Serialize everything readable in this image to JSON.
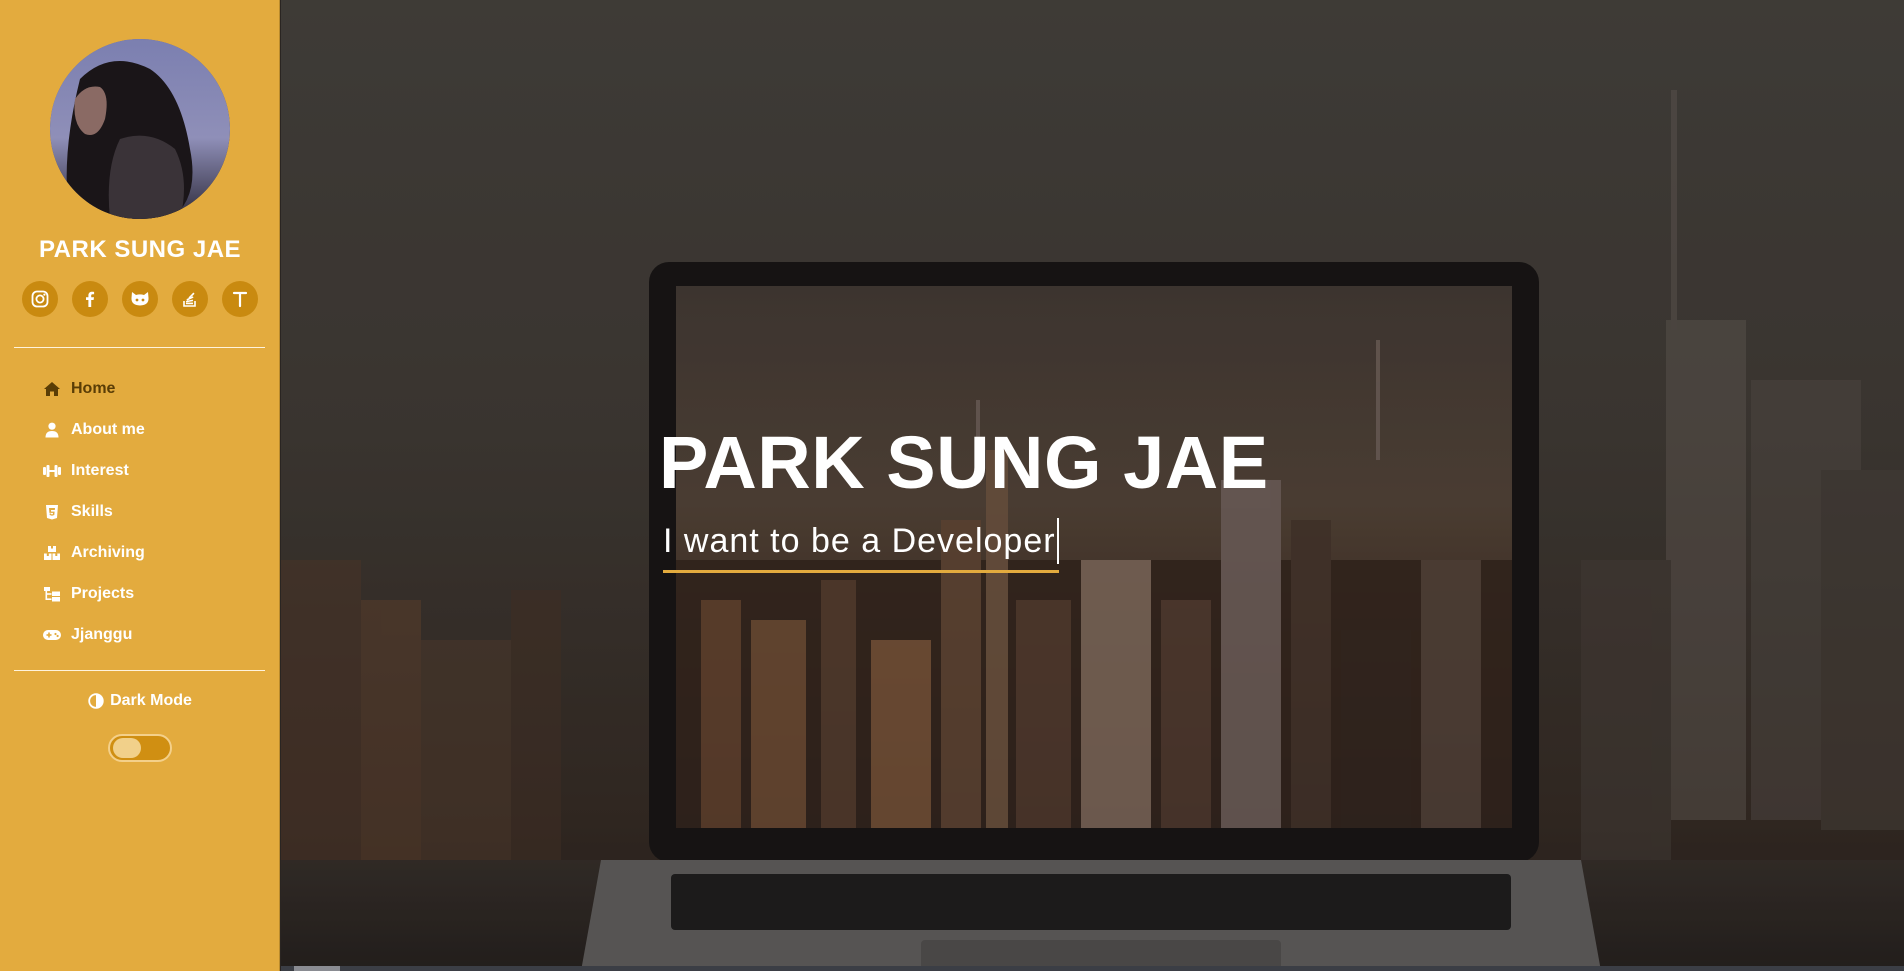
{
  "profile": {
    "name": "PARK SUNG JAE"
  },
  "social": [
    {
      "icon": "instagram-icon"
    },
    {
      "icon": "facebook-icon"
    },
    {
      "icon": "github-icon"
    },
    {
      "icon": "stackoverflow-icon"
    },
    {
      "icon": "tistory-icon",
      "glyph": "T"
    }
  ],
  "nav": {
    "items": [
      {
        "label": "Home",
        "icon": "home-icon",
        "active": true
      },
      {
        "label": "About me",
        "icon": "user-icon"
      },
      {
        "label": "Interest",
        "icon": "dumbbell-icon"
      },
      {
        "label": "Skills",
        "icon": "html5-icon"
      },
      {
        "label": "Archiving",
        "icon": "boxes-icon"
      },
      {
        "label": "Projects",
        "icon": "folder-tree-icon"
      },
      {
        "label": "Jjanggu",
        "icon": "gamepad-icon"
      }
    ]
  },
  "dark_mode": {
    "label": "Dark Mode",
    "enabled": false
  },
  "hero": {
    "title": "PARK SUNG JAE",
    "subtitle": "I want to be a Developer"
  },
  "colors": {
    "sidebar": "#e3ab3e",
    "accent": "#c98a10",
    "active_text": "#5a3d06"
  }
}
